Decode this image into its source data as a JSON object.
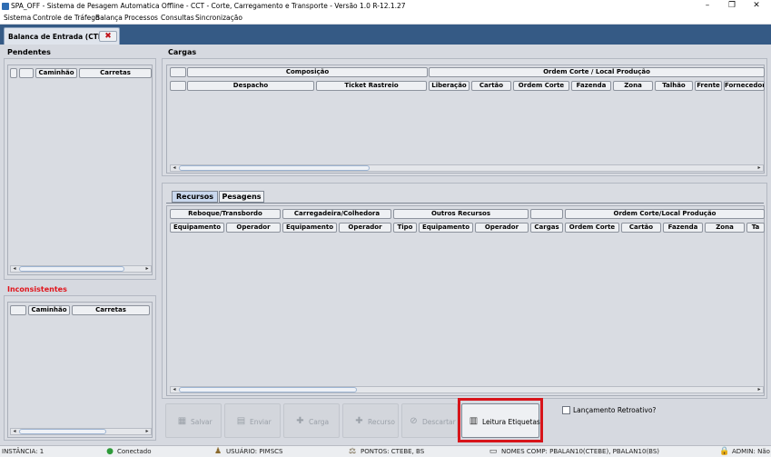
{
  "window": {
    "title": "SPA_OFF - Sistema de Pesagem Automatica Offline - CCT - Corte, Carregamento e Transporte - Versão 1.0 R-12.1.27",
    "controls": {
      "minimize": "–",
      "maximize": "❐",
      "close": "✕"
    }
  },
  "menu": [
    "Sistema",
    "Controle de Tráfego",
    "Balança",
    "Processos",
    "Consultas",
    "Sincronização"
  ],
  "tab": {
    "label": "Balanca de Entrada (CTEBE)",
    "close_glyph": "✖"
  },
  "pendentes": {
    "title": "Pendentes",
    "columns": [
      "",
      "",
      "Caminhão",
      "Carretas"
    ]
  },
  "inconsistentes": {
    "title": "Inconsistentes",
    "title_color": "#e0141b",
    "columns": [
      "",
      "Caminhão",
      "Carretas"
    ]
  },
  "cargas": {
    "title": "Cargas",
    "group_headers": [
      "",
      "Composição",
      "Ordem Corte / Local Produção"
    ],
    "columns": [
      "",
      "Despacho",
      "Ticket Rastreio",
      "Liberação",
      "Cartão",
      "Ordem Corte",
      "Fazenda",
      "Zona",
      "Talhão",
      "Frente",
      "Fornecedor"
    ]
  },
  "subtabs": [
    "Recursos",
    "Pesagens"
  ],
  "recursos": {
    "group_headers": [
      "Reboque/Transbordo",
      "Carregadeira/Colhedora",
      "Outros Recursos",
      "",
      "Ordem Corte/Local Produção"
    ],
    "columns": [
      "Equipamento",
      "Operador",
      "Equipamento",
      "Operador",
      "Tipo",
      "Equipamento",
      "Operador",
      "Cargas",
      "Ordem Corte",
      "Cartão",
      "Fazenda",
      "Zona",
      "Ta"
    ]
  },
  "buttons": {
    "salvar": "Salvar",
    "enviar": "Enviar",
    "carga": "Carga",
    "recurso": "Recurso",
    "descartar": "Descartar",
    "leitura": "Leitura Etiquetas"
  },
  "retroativo": {
    "label": "Lançamento Retroativo?",
    "checked": false
  },
  "status": {
    "instancia": "INSTÂNCIA: 1",
    "conexao": "Conectado",
    "usuario": "USUÁRIO: PIMSCS",
    "pontos": "PONTOS: CTEBE, BS",
    "nomes": "NOMES COMP: PBALAN10(CTEBE), PBALAN10(BS)",
    "admin": "ADMIN: Não"
  },
  "colors": {
    "tabstrip": "#355a85",
    "highlight": "#d7141a",
    "accent_green": "#2e9a3a"
  }
}
